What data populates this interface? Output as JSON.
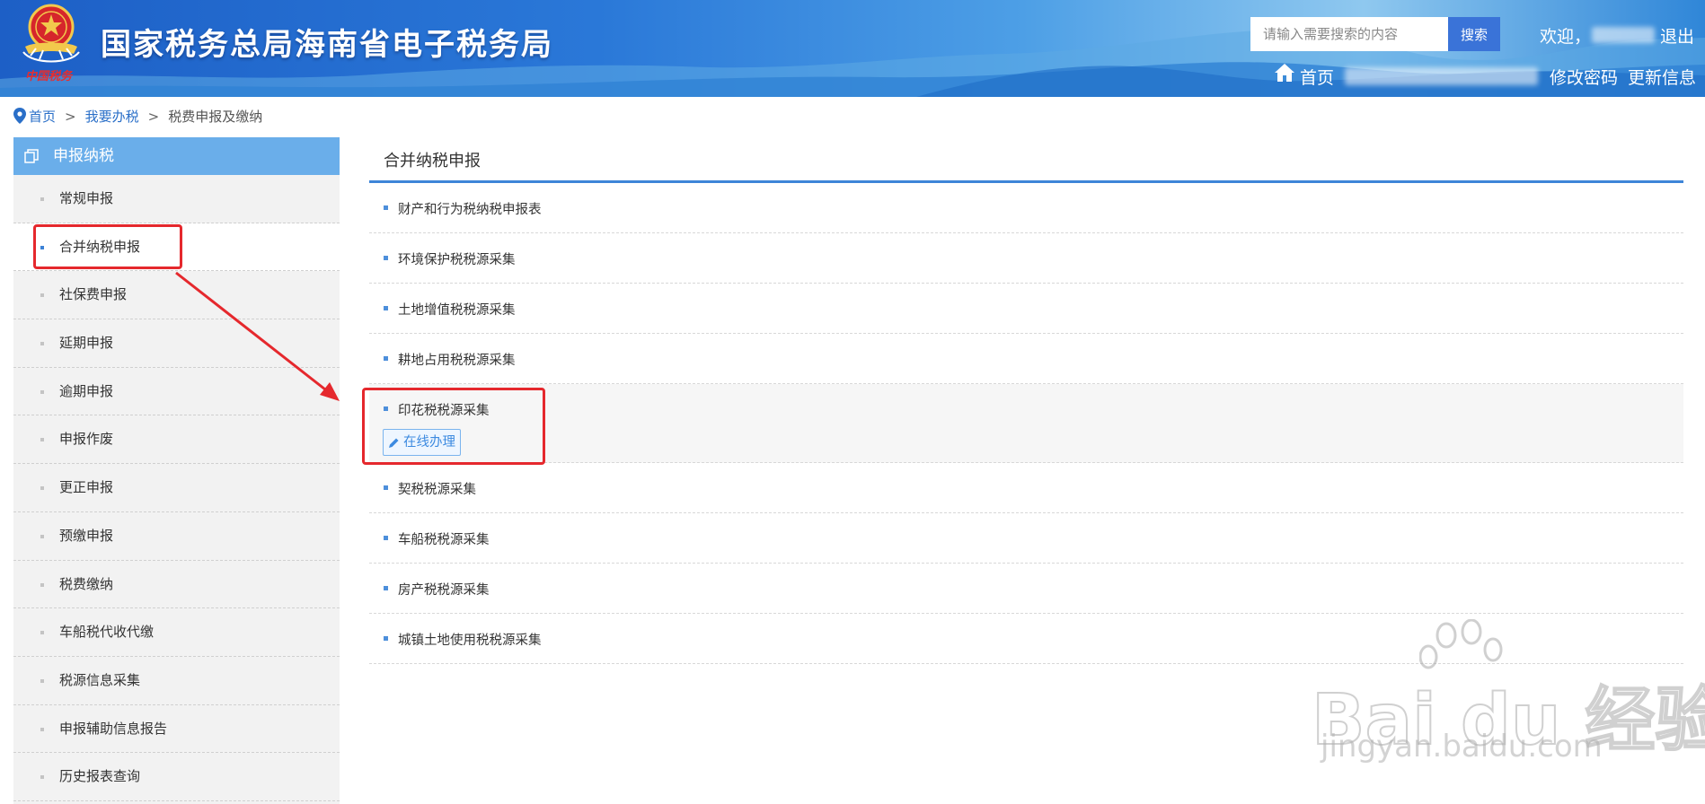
{
  "header": {
    "site_title": "国家税务总局海南省电子税务局",
    "emblem_text": "中国税务",
    "search_placeholder": "请输入需要搜索的内容",
    "search_button": "搜索",
    "welcome": "欢迎，",
    "logout": "退出",
    "nav_home": "首页",
    "nav_change_password": "修改密码",
    "nav_update_info": "更新信息"
  },
  "breadcrumb": {
    "home": "首页",
    "sep": ">",
    "level2": "我要办税",
    "current": "税费申报及缴纳"
  },
  "sidebar": {
    "header": "申报纳税",
    "items": [
      {
        "label": "常规申报"
      },
      {
        "label": "合并纳税申报",
        "active": true
      },
      {
        "label": "社保费申报"
      },
      {
        "label": "延期申报"
      },
      {
        "label": "逾期申报"
      },
      {
        "label": "申报作废"
      },
      {
        "label": "更正申报"
      },
      {
        "label": "预缴申报"
      },
      {
        "label": "税费缴纳"
      },
      {
        "label": "车船税代收代缴"
      },
      {
        "label": "税源信息采集"
      },
      {
        "label": "申报辅助信息报告"
      },
      {
        "label": "历史报表查询"
      }
    ]
  },
  "main": {
    "title": "合并纳税申报",
    "items": [
      {
        "label": "财产和行为税纳税申报表"
      },
      {
        "label": "环境保护税税源采集"
      },
      {
        "label": "土地增值税税源采集"
      },
      {
        "label": "耕地占用税税源采集"
      },
      {
        "label": "印花税税源采集",
        "action": "在线办理"
      },
      {
        "label": "契税税源采集"
      },
      {
        "label": "车船税税源采集"
      },
      {
        "label": "房产税税源采集"
      },
      {
        "label": "城镇土地使用税税源采集"
      }
    ]
  },
  "watermark": {
    "brand": "Bai du 经验",
    "url": "jingyan.baidu.com"
  },
  "colors": {
    "header_blue": "#2a78d8",
    "sidebar_header": "#6aaeea",
    "accent": "#3e85d8",
    "annotation_red": "#e5282d"
  }
}
